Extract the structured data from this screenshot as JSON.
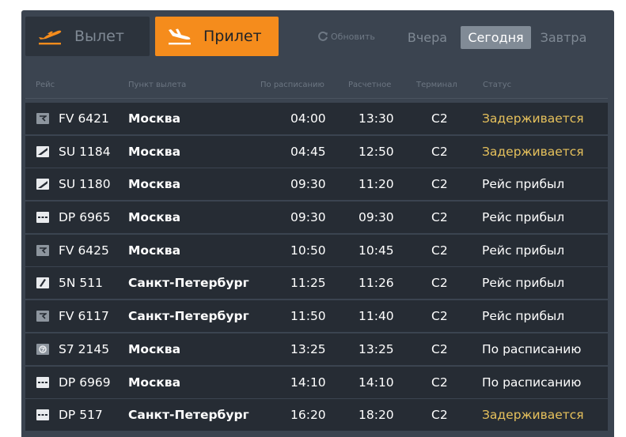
{
  "tabs": {
    "departure": "Вылет",
    "arrival": "Прилет"
  },
  "refresh_label": "Обновить",
  "days": {
    "yesterday": "Вчера",
    "today": "Сегодня",
    "tomorrow": "Завтра"
  },
  "columns": {
    "flight": "Рейс",
    "origin": "Пункт вылета",
    "scheduled": "По расписанию",
    "estimated": "Расчетное",
    "terminal": "Терминал",
    "status": "Статус"
  },
  "colors": {
    "accent": "#f58c1c",
    "board": "#3b4450",
    "row": "#262c34",
    "delayed": "#e6c15c"
  },
  "flights": [
    {
      "airline_icon": "nordwind-icon",
      "flight": "FV 6421",
      "origin": "Москва",
      "scheduled": "04:00",
      "estimated": "13:30",
      "terminal": "C2",
      "status": "Задерживается",
      "delayed": true
    },
    {
      "airline_icon": "aeroflot-icon",
      "flight": "SU 1184",
      "origin": "Москва",
      "scheduled": "04:45",
      "estimated": "12:50",
      "terminal": "C2",
      "status": "Задерживается",
      "delayed": true
    },
    {
      "airline_icon": "aeroflot-icon",
      "flight": "SU 1180",
      "origin": "Москва",
      "scheduled": "09:30",
      "estimated": "11:20",
      "terminal": "C2",
      "status": "Рейс прибыл",
      "delayed": false
    },
    {
      "airline_icon": "pobeda-icon",
      "flight": "DP 6965",
      "origin": "Москва",
      "scheduled": "09:30",
      "estimated": "09:30",
      "terminal": "C2",
      "status": "Рейс прибыл",
      "delayed": false
    },
    {
      "airline_icon": "nordwind-icon",
      "flight": "FV 6425",
      "origin": "Москва",
      "scheduled": "10:50",
      "estimated": "10:45",
      "terminal": "C2",
      "status": "Рейс прибыл",
      "delayed": false
    },
    {
      "airline_icon": "smartavia-icon",
      "flight": "5N 511",
      "origin": "Санкт-Петербург",
      "scheduled": "11:25",
      "estimated": "11:26",
      "terminal": "C2",
      "status": "Рейс прибыл",
      "delayed": false
    },
    {
      "airline_icon": "nordwind-icon",
      "flight": "FV 6117",
      "origin": "Санкт-Петербург",
      "scheduled": "11:50",
      "estimated": "11:40",
      "terminal": "C2",
      "status": "Рейс прибыл",
      "delayed": false
    },
    {
      "airline_icon": "s7-icon",
      "flight": "S7 2145",
      "origin": "Москва",
      "scheduled": "13:25",
      "estimated": "13:25",
      "terminal": "C2",
      "status": "По расписанию",
      "delayed": false
    },
    {
      "airline_icon": "pobeda-icon",
      "flight": "DP 6969",
      "origin": "Москва",
      "scheduled": "14:10",
      "estimated": "14:10",
      "terminal": "C2",
      "status": "По расписанию",
      "delayed": false
    },
    {
      "airline_icon": "pobeda-icon",
      "flight": "DP 517",
      "origin": "Санкт-Петербург",
      "scheduled": "16:20",
      "estimated": "18:20",
      "terminal": "C2",
      "status": "Задерживается",
      "delayed": true
    }
  ]
}
